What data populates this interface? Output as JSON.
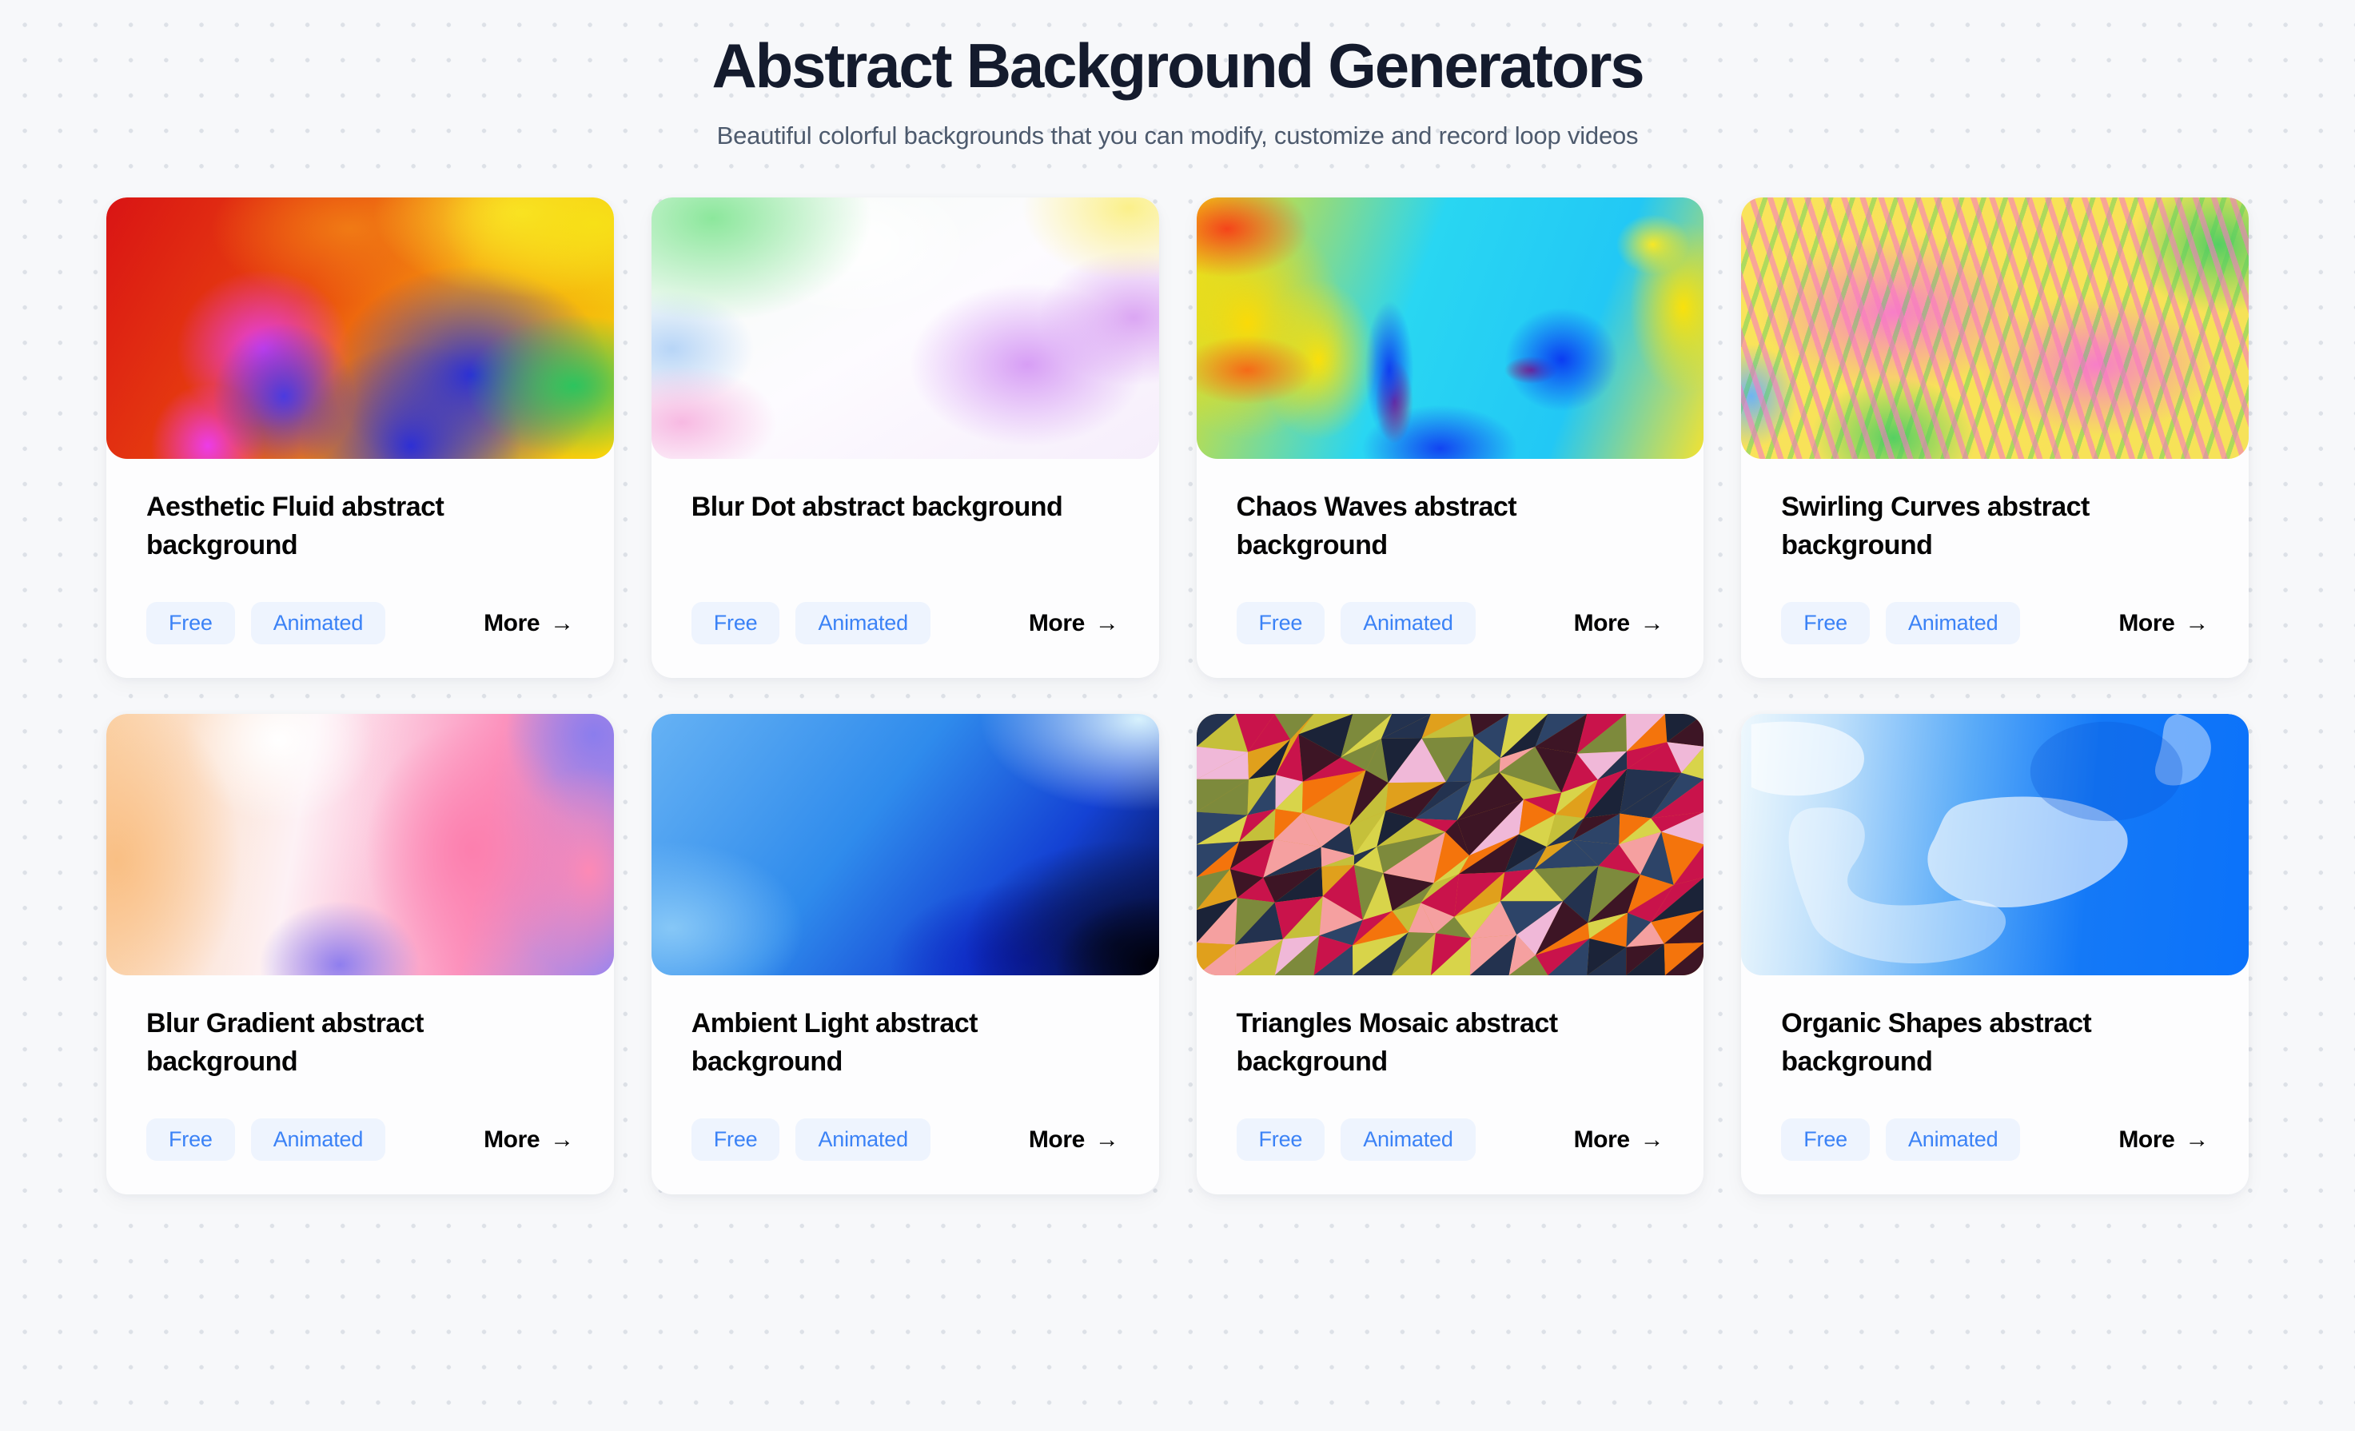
{
  "header": {
    "title": "Abstract Background Generators",
    "subtitle": "Beautiful colorful backgrounds that you can modify, customize and record loop videos"
  },
  "colors": {
    "page_background": "#f7f8fa",
    "dot_grid": "#dde1e7",
    "title": "#141b2d",
    "subtitle": "#4d5a6d",
    "card_background": "#fdfdfe",
    "tag_background": "#eef4fe",
    "tag_text": "#3b82f6",
    "more_text": "#000000"
  },
  "cards": [
    {
      "title": "Aesthetic Fluid abstract background",
      "tags": [
        "Free",
        "Animated"
      ],
      "more_label": "More",
      "more_arrow": "→",
      "thumb_class": "thumb-fluid",
      "thumb_name": "aesthetic-fluid-preview"
    },
    {
      "title": "Blur Dot abstract background",
      "tags": [
        "Free",
        "Animated"
      ],
      "more_label": "More",
      "more_arrow": "→",
      "thumb_class": "thumb-blurdot",
      "thumb_name": "blur-dot-preview"
    },
    {
      "title": "Chaos Waves abstract background",
      "tags": [
        "Free",
        "Animated"
      ],
      "more_label": "More",
      "more_arrow": "→",
      "thumb_class": "thumb-chaos",
      "thumb_name": "chaos-waves-preview"
    },
    {
      "title": "Swirling Curves abstract background",
      "tags": [
        "Free",
        "Animated"
      ],
      "more_label": "More",
      "more_arrow": "→",
      "thumb_class": "thumb-swirl",
      "thumb_name": "swirling-curves-preview"
    },
    {
      "title": "Blur Gradient abstract background",
      "tags": [
        "Free",
        "Animated"
      ],
      "more_label": "More",
      "more_arrow": "→",
      "thumb_class": "thumb-blurgrad",
      "thumb_name": "blur-gradient-preview"
    },
    {
      "title": "Ambient Light abstract background",
      "tags": [
        "Free",
        "Animated"
      ],
      "more_label": "More",
      "more_arrow": "→",
      "thumb_class": "thumb-ambient",
      "thumb_name": "ambient-light-preview"
    },
    {
      "title": "Triangles Mosaic abstract background",
      "tags": [
        "Free",
        "Animated"
      ],
      "more_label": "More",
      "more_arrow": "→",
      "thumb_class": "thumb-tri",
      "thumb_name": "triangles-mosaic-preview"
    },
    {
      "title": "Organic Shapes abstract background",
      "tags": [
        "Free",
        "Animated"
      ],
      "more_label": "More",
      "more_arrow": "→",
      "thumb_class": "thumb-organic",
      "thumb_name": "organic-shapes-preview"
    }
  ]
}
